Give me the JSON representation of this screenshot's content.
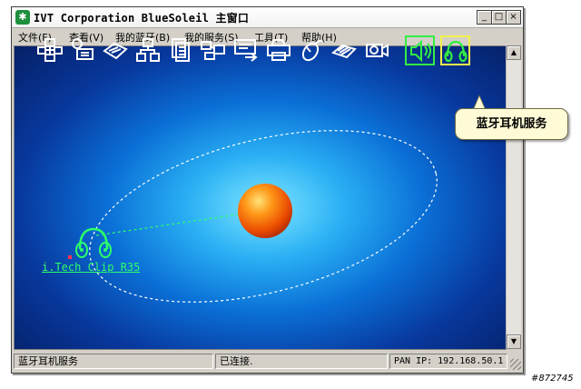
{
  "window": {
    "title": "IVT Corporation BlueSoleil 主窗口",
    "buttons": {
      "minimize": "_",
      "maximize": "□",
      "close": "×"
    }
  },
  "menu": [
    "文件(F)",
    "查看(V)",
    "我的蓝牙(B)",
    "我的服务(S)",
    "工具(T)",
    "帮助(H)"
  ],
  "toolbar_services": [
    "network-access-icon",
    "dialup-networking-icon",
    "fax-icon",
    "lan-access-icon",
    "file-transfer-icon",
    "personal-area-network-icon",
    "object-push-icon",
    "printer-icon",
    "hid-mouse-icon",
    "sync-icon",
    "camera-icon",
    "audio-gateway-icon",
    "headset-service-icon"
  ],
  "tooltip": "蓝牙耳机服务",
  "device": {
    "name": "i.Tech Clip R35",
    "icon": "headset-icon"
  },
  "status": {
    "service": "蓝牙耳机服务",
    "connection": "已连接.",
    "pan_ip": "PAN IP: 192.168.50.1"
  },
  "watermark": "#872745",
  "colors": {
    "link": "#2cff6a",
    "selected_border": "#33ee44",
    "tooltip_bg": "#fffbd6"
  }
}
